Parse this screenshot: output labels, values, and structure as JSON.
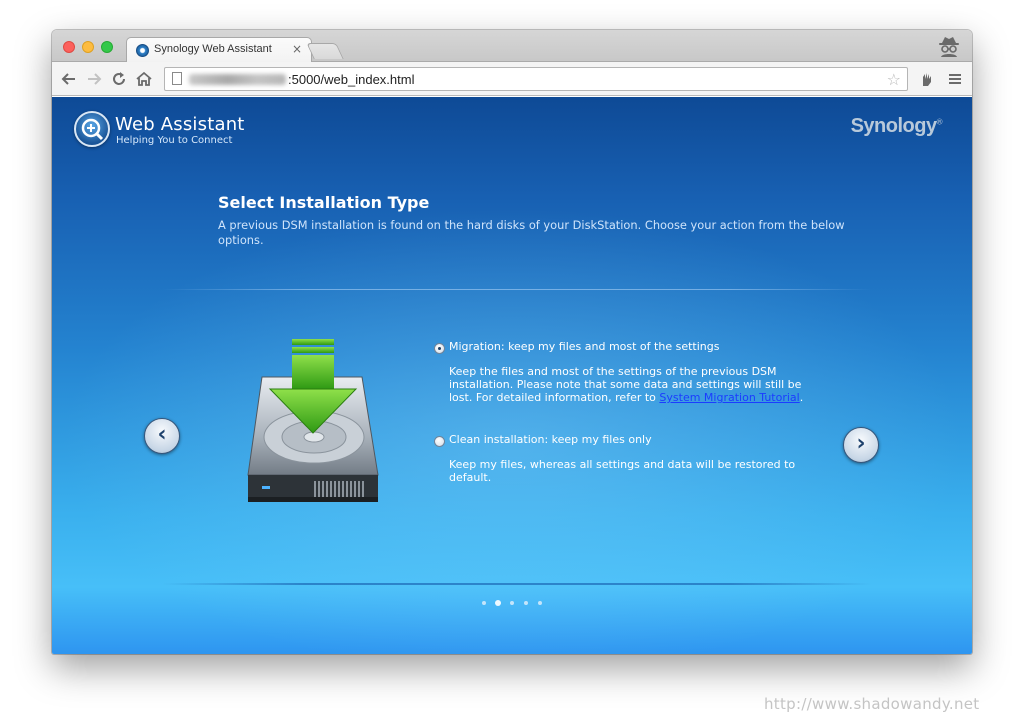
{
  "browser": {
    "tab_title": "Synology Web Assistant",
    "tab_close": "×",
    "url_visible": ":5000/web_index.html",
    "nav_icons": [
      "back-arrow-icon",
      "forward-arrow-icon",
      "reload-icon",
      "home-icon"
    ]
  },
  "header": {
    "title": "Web Assistant",
    "subtitle": "Helping You to Connect",
    "brand": "Synology"
  },
  "main": {
    "heading": "Select Installation Type",
    "description": "A previous DSM installation is found on the hard disks of your DiskStation. Choose your action from the below options."
  },
  "options": [
    {
      "label": "Migration: keep my files and most of the settings",
      "checked": true,
      "desc_before_link": "Keep the files and most of the settings of the previous DSM installation. Please note that some data and settings will still be lost. For detailed information, refer to ",
      "link_text": "System Migration Tutorial",
      "desc_after_link": "."
    },
    {
      "label": "Clean installation: keep my files only",
      "checked": false,
      "desc": "Keep my files, whereas all settings and data will be restored to default."
    }
  ],
  "carousel": {
    "total_steps": 5,
    "active_step": 2,
    "prev_label": "‹",
    "next_label": "›"
  },
  "watermark": "http://www.shadowandy.net",
  "colors": {
    "accent_green": "#5cc02c",
    "link": "#1b3cff",
    "bg_dark": "#0e4a96",
    "bg_light": "#47bff8"
  }
}
